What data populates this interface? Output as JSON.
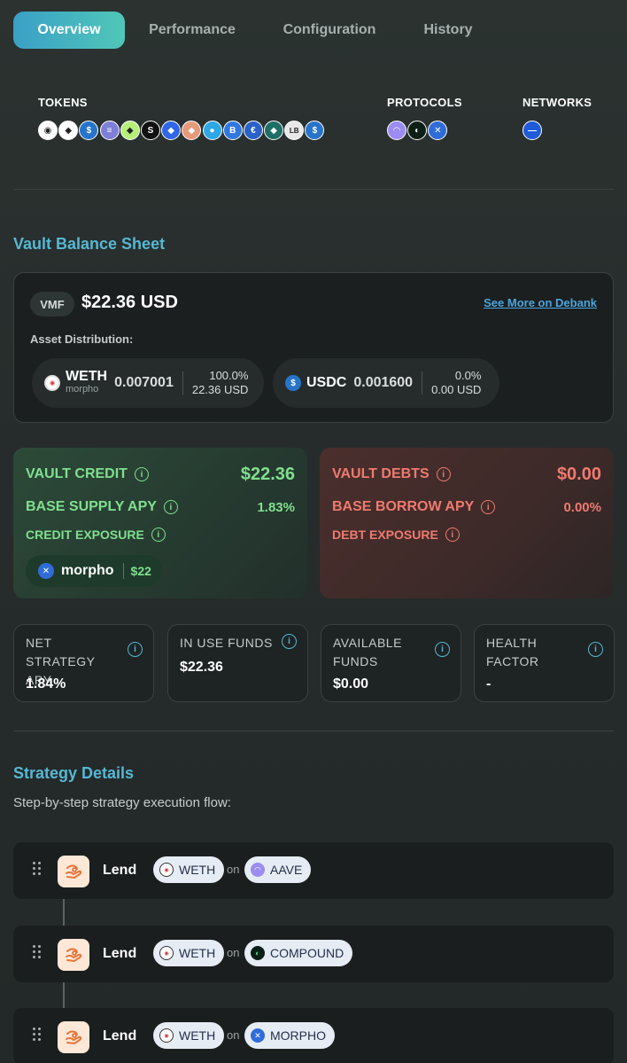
{
  "tabs": [
    {
      "label": "Overview",
      "active": true
    },
    {
      "label": "Performance",
      "active": false
    },
    {
      "label": "Configuration",
      "active": false
    },
    {
      "label": "History",
      "active": false
    }
  ],
  "tokens_header": {
    "tokens_label": "TOKENS",
    "protocols_label": "PROTOCOLS",
    "networks_label": "NETWORKS",
    "tokens": [
      {
        "icon": "weth-token-icon",
        "color": "#ffffff",
        "glyph": "◉"
      },
      {
        "icon": "eth-token-icon",
        "color": "#ffffff",
        "glyph": "◆"
      },
      {
        "icon": "usdc-token-icon",
        "color": "#2775ca",
        "glyph": "$"
      },
      {
        "icon": "striped-token-icon",
        "color": "#7d7fd8",
        "glyph": "≡"
      },
      {
        "icon": "green-eth-token-icon",
        "color": "#b6f07a",
        "glyph": "◆"
      },
      {
        "icon": "black-s-token-icon",
        "color": "#111111",
        "glyph": "S"
      },
      {
        "icon": "blue-eth-token-icon",
        "color": "#3166e8",
        "glyph": "◆"
      },
      {
        "icon": "orange-eth-token-icon",
        "color": "#e79a7a",
        "glyph": "◆"
      },
      {
        "icon": "drop-token-icon",
        "color": "#2ea7e6",
        "glyph": "●"
      },
      {
        "icon": "btc-token-icon",
        "color": "#3078e0",
        "glyph": "B"
      },
      {
        "icon": "euro-token-icon",
        "color": "#2b62c8",
        "glyph": "€"
      },
      {
        "icon": "teal-eth-token-icon",
        "color": "#1f6e66",
        "glyph": "◆"
      },
      {
        "icon": "lb-token-icon",
        "color": "#e8e8e8",
        "glyph": "LB"
      },
      {
        "icon": "usdc2-token-icon",
        "color": "#2775ca",
        "glyph": "$"
      }
    ],
    "protocols": [
      {
        "icon": "aave-protocol-icon",
        "color": "#9a8cf0",
        "glyph": "◠"
      },
      {
        "icon": "compound-protocol-icon",
        "color": "#0b1f16",
        "glyph": "◐"
      },
      {
        "icon": "morpho-protocol-icon",
        "color": "#2f6cd8",
        "glyph": "✕"
      }
    ],
    "networks": [
      {
        "icon": "base-network-icon",
        "color": "#1f5bd8",
        "glyph": "—"
      }
    ]
  },
  "balance_sheet": {
    "title": "Vault Balance Sheet",
    "vault_tag": "VMF",
    "balance": "$22.36 USD",
    "debank_link": "See More on Debank",
    "asset_distribution_label": "Asset Distribution:",
    "assets": [
      {
        "symbol": "WETH",
        "sub": "morpho",
        "amount": "0.007001",
        "percent": "100.0%",
        "usd": "22.36 USD",
        "icon": "weth-icon"
      },
      {
        "symbol": "USDC",
        "sub": "",
        "amount": "0.001600",
        "percent": "0.0%",
        "usd": "0.00 USD",
        "icon": "usdc-icon"
      }
    ]
  },
  "credit": {
    "vault_credit_label": "VAULT CREDIT",
    "vault_credit_value": "$22.36",
    "base_supply_apy_label": "BASE SUPPLY APY",
    "base_supply_apy_value": "1.83%",
    "credit_exposure_label": "CREDIT EXPOSURE",
    "exposure_protocol": "morpho",
    "exposure_value": "$22"
  },
  "debt": {
    "vault_debts_label": "VAULT DEBTS",
    "vault_debts_value": "$0.00",
    "base_borrow_apy_label": "BASE BORROW APY",
    "base_borrow_apy_value": "0.00%",
    "debt_exposure_label": "DEBT EXPOSURE"
  },
  "metrics": [
    {
      "label": "NET STRATEGY APY",
      "value": "1.84%"
    },
    {
      "label": "IN USE FUNDS",
      "value": "$22.36"
    },
    {
      "label": "AVAILABLE FUNDS",
      "value": "$0.00"
    },
    {
      "label": "HEALTH FACTOR",
      "value": "-"
    }
  ],
  "strategy": {
    "title": "Strategy Details",
    "description": "Step-by-step strategy execution flow:",
    "steps": [
      {
        "action": "Lend",
        "token": "WETH",
        "connector": "on",
        "protocol": "AAVE"
      },
      {
        "action": "Lend",
        "token": "WETH",
        "connector": "on",
        "protocol": "COMPOUND"
      },
      {
        "action": "Lend",
        "token": "WETH",
        "connector": "on",
        "protocol": "MORPHO"
      }
    ]
  },
  "colors": {
    "accent": "#56b8d3",
    "credit_green": "#7fe08e",
    "debt_red": "#f07a6f"
  }
}
